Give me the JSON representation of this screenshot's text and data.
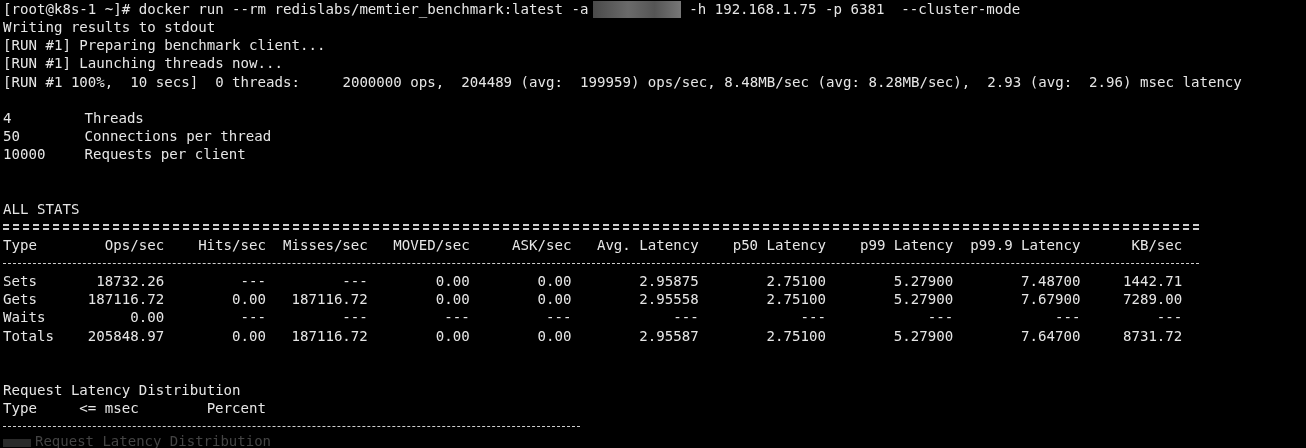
{
  "terminal": {
    "command": {
      "prompt": "[root@k8s-1 ~]#",
      "before_redaction": "docker run --rm redislabs/memtier_benchmark:latest -a",
      "after_redaction": "-h 192.168.1.75 -p 6381  --cluster-mode"
    },
    "output_lines": [
      "Writing results to stdout",
      "[RUN #1] Preparing benchmark client...",
      "[RUN #1] Launching threads now...",
      "[RUN #1 100%,  10 secs]  0 threads:     2000000 ops,  204489 (avg:  199959) ops/sec, 8.48MB/sec (avg: 8.28MB/sec),  2.93 (avg:  2.96) msec latency"
    ],
    "config": [
      {
        "value": "4",
        "label": "Threads"
      },
      {
        "value": "50",
        "label": "Connections per thread"
      },
      {
        "value": "10000",
        "label": "Requests per client"
      }
    ],
    "stats": {
      "title": "ALL STATS",
      "columns": [
        "Type",
        "Ops/sec",
        "Hits/sec",
        "Misses/sec",
        "MOVED/sec",
        "ASK/sec",
        "Avg. Latency",
        "p50 Latency",
        "p99 Latency",
        "p99.9 Latency",
        "KB/sec"
      ],
      "rows": [
        [
          "Sets",
          "18732.26",
          "---",
          "---",
          "0.00",
          "0.00",
          "2.95875",
          "2.75100",
          "5.27900",
          "7.48700",
          "1442.71"
        ],
        [
          "Gets",
          "187116.72",
          "0.00",
          "187116.72",
          "0.00",
          "0.00",
          "2.95558",
          "2.75100",
          "5.27900",
          "7.67900",
          "7289.00"
        ],
        [
          "Waits",
          "0.00",
          "---",
          "---",
          "---",
          "---",
          "---",
          "---",
          "---",
          "---",
          "---"
        ],
        [
          "Totals",
          "205848.97",
          "0.00",
          "187116.72",
          "0.00",
          "0.00",
          "2.95587",
          "2.75100",
          "5.27900",
          "7.64700",
          "8731.72"
        ]
      ]
    },
    "distribution": {
      "title": "Request Latency Distribution",
      "columns": [
        "Type",
        "<= msec",
        "Percent"
      ]
    },
    "faded_line": "Request Latency Distribution"
  }
}
